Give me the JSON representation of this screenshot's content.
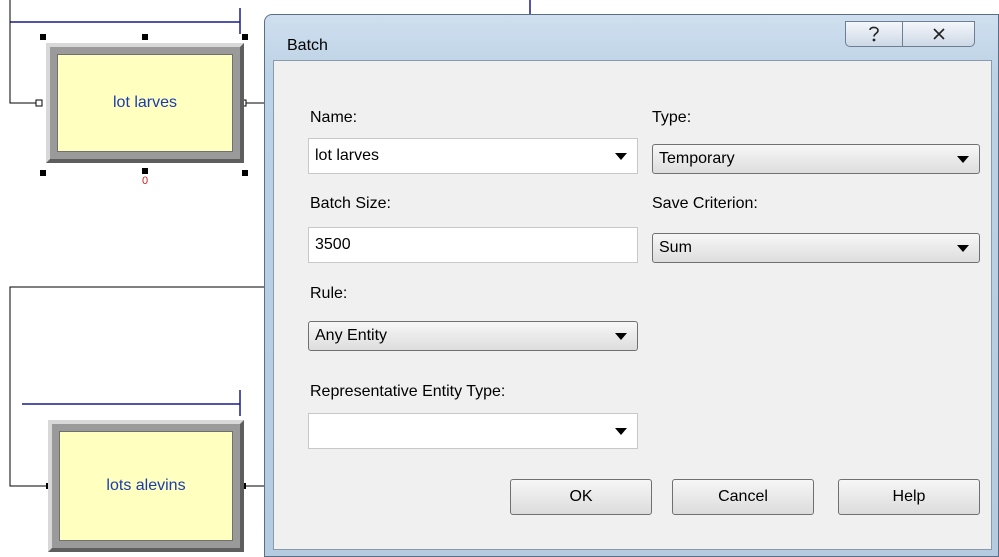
{
  "canvas": {
    "modules": [
      {
        "label": "lot larves"
      },
      {
        "label": "lots alevins"
      }
    ],
    "animation_marker": "0"
  },
  "dialog": {
    "title": "Batch",
    "help_button_icon": "question-mark-icon",
    "close_button_icon": "close-x-icon",
    "name_label": "Name:",
    "name_value": "lot larves",
    "type_label": "Type:",
    "type_value": "Temporary",
    "batch_size_label": "Batch Size:",
    "batch_size_value": "3500",
    "save_criterion_label": "Save Criterion:",
    "save_criterion_value": "Sum",
    "rule_label": "Rule:",
    "rule_value": "Any Entity",
    "rep_entity_type_label": "Representative Entity Type:",
    "rep_entity_type_value": "",
    "ok_label": "OK",
    "cancel_label": "Cancel",
    "help_label": "Help"
  },
  "colors": {
    "connector_line": "#1a1a8c",
    "module_label": "#1a3cb0",
    "module_face": "#ffffc0",
    "dialog_frame": "#bcd2e6"
  }
}
